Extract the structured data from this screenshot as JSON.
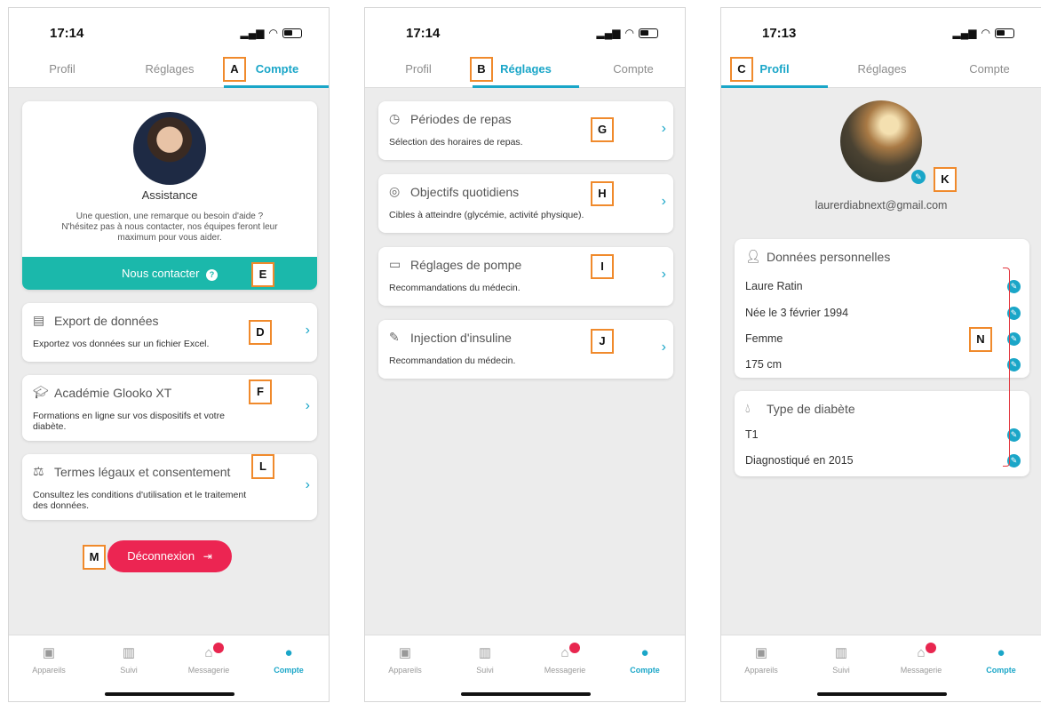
{
  "status": {
    "p1_time": "17:14",
    "p2_time": "17:14",
    "p3_time": "17:13"
  },
  "tabs": [
    "Profil",
    "Réglages",
    "Compte"
  ],
  "accent_color": "#1aa6c8",
  "logout_color": "#ec2552",
  "contact_color": "#1bb8ab",
  "screen1": {
    "assistance_title": "Assistance",
    "assistance_text_1": "Une question, une remarque ou besoin d'aide ?",
    "assistance_text_2": "N'hésitez pas à nous contacter, nos équipes feront leur",
    "assistance_text_3": "maximum pour vous aider.",
    "contact_button": "Nous contacter",
    "export_title": "Export de données",
    "export_desc": "Exportez vos données sur un fichier Excel.",
    "academy_title": "Académie Glooko XT",
    "academy_desc_1": "Formations en ligne sur vos dispositifs et votre",
    "academy_desc_2": "diabète.",
    "legal_title": "Termes légaux et consentement",
    "legal_desc_1": "Consultez les conditions d'utilisation et le traitement",
    "legal_desc_2": "des données.",
    "logout_button": "Déconnexion"
  },
  "screen2": {
    "meals_title": "Périodes de repas",
    "meals_desc": "Sélection des horaires de repas.",
    "goals_title": "Objectifs quotidiens",
    "goals_desc": "Cibles à atteindre (glycémie, activité physique).",
    "pump_title": "Réglages de pompe",
    "pump_desc": "Recommandations du médecin.",
    "insulin_title": "Injection d'insuline",
    "insulin_desc": "Recommandation du médecin."
  },
  "screen3": {
    "email": "laurerdiabnext@gmail.com",
    "personal_title": "Données personnelles",
    "name": "Laure Ratin",
    "birth": "Née le 3 février 1994",
    "gender": "Femme",
    "height": "175 cm",
    "diabetes_title": "Type de diabète",
    "diabetes_type": "T1",
    "diagnosed": "Diagnostiqué en 2015"
  },
  "nav": [
    "Appareils",
    "Suivi",
    "Messagerie",
    "Compte"
  ],
  "markers": [
    "A",
    "B",
    "C",
    "D",
    "E",
    "F",
    "G",
    "H",
    "I",
    "J",
    "K",
    "L",
    "M",
    "N"
  ]
}
